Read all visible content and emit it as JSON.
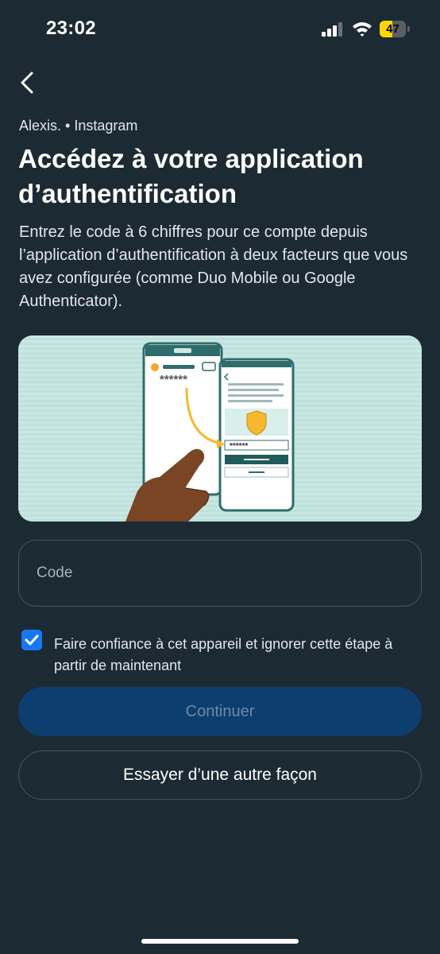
{
  "status_bar": {
    "time": "23:02",
    "battery_level": "47",
    "battery_fraction": 0.47,
    "battery_color": "#ffd60a",
    "icons": [
      "signal-icon",
      "wifi-icon",
      "battery-icon"
    ]
  },
  "header": {
    "back_icon": "chevron-left-icon"
  },
  "main": {
    "account": "Alexis. • Instagram",
    "title": "Accédez à votre application d’authentification",
    "description": "Entrez le code à 6 chiffres pour ce compte depuis l’application d’authentification à deux facteurs que vous avez configurée (comme Duo Mobile ou Google Authenticator).",
    "illustration": {
      "masked_code": "******",
      "icons": [
        "shield-icon",
        "hand-icon",
        "arrow-icon",
        "key-icon"
      ]
    },
    "code_input": {
      "placeholder": "Code",
      "value": ""
    },
    "trust_device": {
      "checked": true,
      "label": "Faire confiance à cet appareil et ignorer cette étape à partir de maintenant"
    },
    "continue_label": "Continuer",
    "other_way_label": "Essayer d’une autre façon"
  },
  "colors": {
    "background": "#1c2b33",
    "primary_blue": "#1877f2",
    "disabled_button": "#0e3d6f",
    "illustration_bg": "#c5e5e1",
    "teal_accent": "#2e6d6b",
    "shield_yellow": "#f5b92e"
  }
}
